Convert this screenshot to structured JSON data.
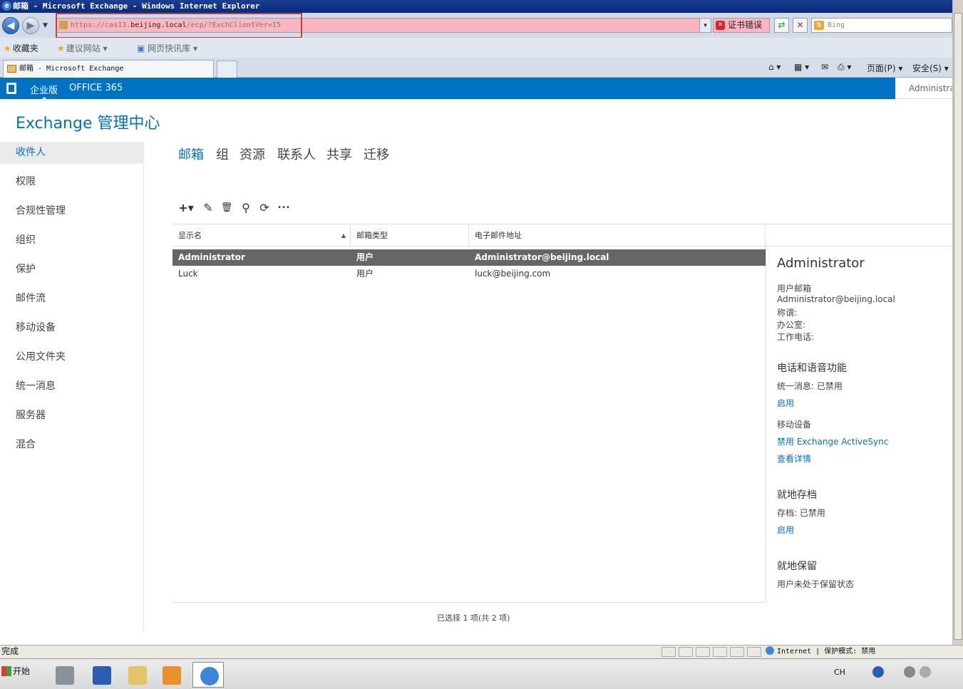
{
  "window": {
    "title": "邮箱 - Microsoft Exchange - Windows Internet Explorer"
  },
  "address": {
    "scheme": "https://cas13.",
    "host": "beijing.local",
    "path": "/ecp/?ExchClientVer=15",
    "cert_error": "证书错误",
    "search_placeholder": "Bing"
  },
  "favorites": {
    "label": "收藏夹",
    "suggested": "建议网站 ▾",
    "webslice": "网页快讯库 ▾"
  },
  "tab": {
    "title": "邮箱 - Microsoft Exchange"
  },
  "commands": {
    "page": "页面(P) ▾",
    "safety": "安全(S) ▾"
  },
  "o365": {
    "enterprise": "企业版",
    "office365": "OFFICE 365",
    "user": "Administrator"
  },
  "eac": {
    "title": "Exchange 管理中心"
  },
  "leftnav": [
    "收件人",
    "权限",
    "合规性管理",
    "组织",
    "保护",
    "邮件流",
    "移动设备",
    "公用文件夹",
    "统一消息",
    "服务器",
    "混合"
  ],
  "subtabs": [
    "邮箱",
    "组",
    "资源",
    "联系人",
    "共享",
    "迁移"
  ],
  "toolbar": {
    "add": "+▾",
    "edit": "✎",
    "delete": "🗑",
    "search": "⚲",
    "refresh": "⟳",
    "more": "•••"
  },
  "grid": {
    "columns": [
      "显示名",
      "邮箱类型",
      "电子邮件地址"
    ],
    "rows": [
      {
        "name": "Administrator",
        "type": "用户",
        "email": "Administrator@beijing.local"
      },
      {
        "name": "Luck",
        "type": "用户",
        "email": "luck@beijing.com"
      }
    ],
    "status": "已选择 1 项(共 2 项)"
  },
  "detail": {
    "name": "Administrator",
    "mailbox_type": "用户邮箱",
    "email": "Administrator@beijing.local",
    "title_label": "称谓:",
    "office_label": "办公室:",
    "phone_label": "工作电话:",
    "phone_voice_header": "电话和语音功能",
    "um_status": "统一消息: 已禁用",
    "enable_um": "启用",
    "mobile_label": "移动设备",
    "disable_eas": "禁用 Exchange ActiveSync",
    "view_details": "查看详情",
    "archive_header": "就地存档",
    "archive_status": "存档: 已禁用",
    "enable_archive": "启用",
    "hold_header": "就地保留",
    "hold_status": "用户未处于保留状态"
  },
  "statusbar": {
    "text": "完成",
    "zone": "Internet | 保护模式: 禁用"
  },
  "taskbar": {
    "start": "开始",
    "lang": "CH"
  }
}
